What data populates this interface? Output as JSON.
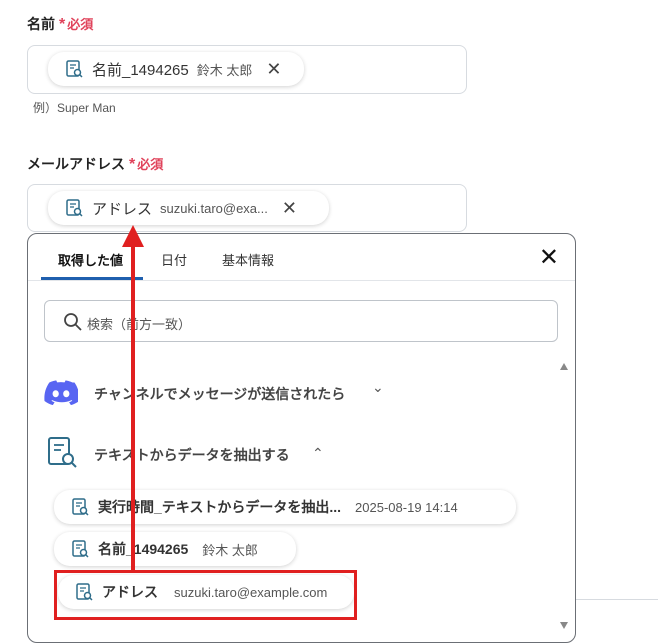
{
  "form": {
    "name_label": "名前",
    "required_star": "*",
    "required_text": "必須",
    "name_chip": {
      "name": "名前_1494265",
      "value": "鈴木 太郎",
      "close": "✕"
    },
    "name_hint": "例）Super Man",
    "email_label": "メールアドレス",
    "email_chip": {
      "name": "アドレス",
      "value": "suzuki.taro@exa...",
      "close": "✕"
    }
  },
  "popup": {
    "tabs": [
      "取得した値",
      "日付",
      "基本情報"
    ],
    "close": "✕",
    "search_placeholder": "検索（前方一致）",
    "sections": [
      {
        "title": "チャンネルでメッセージが送信されたら",
        "chevron": "⌄",
        "icon": "discord-icon"
      },
      {
        "title": "テキストからデータを抽出する",
        "chevron": "⌃",
        "icon": "document-search-icon"
      }
    ],
    "items": [
      {
        "name": "実行時間_テキストからデータを抽出...",
        "value": "2025-08-19 14:14"
      },
      {
        "name": "名前_1494265",
        "value": "鈴木 太郎"
      },
      {
        "name": "アドレス",
        "value": "suzuki.taro@example.com"
      }
    ]
  },
  "colors": {
    "accent": "#1f5fae",
    "required": "#e0435b",
    "highlight": "#e02020",
    "discord": "#5865f2"
  }
}
